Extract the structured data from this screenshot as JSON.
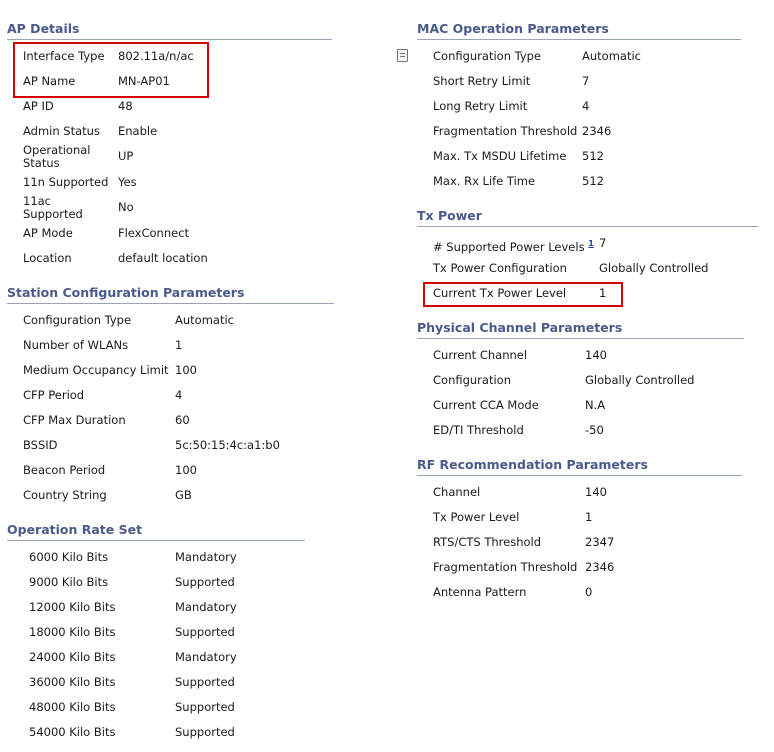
{
  "ap_details": {
    "title": "AP Details",
    "rows": [
      {
        "label": "Interface Type",
        "value": "802.11a/n/ac"
      },
      {
        "label": "AP Name",
        "value": "MN-AP01"
      },
      {
        "label": "AP ID",
        "value": "48"
      },
      {
        "label": "Admin Status",
        "value": "Enable"
      },
      {
        "label": "Operational Status",
        "value": "UP"
      },
      {
        "label": "11n Supported",
        "value": "Yes"
      },
      {
        "label": "11ac Supported",
        "value": "No"
      },
      {
        "label": "AP Mode",
        "value": "FlexConnect"
      },
      {
        "label": "Location",
        "value": "default location"
      }
    ]
  },
  "station_config": {
    "title": "Station Configuration Parameters",
    "rows": [
      {
        "label": "Configuration Type",
        "value": "Automatic"
      },
      {
        "label": "Number of WLANs",
        "value": "1"
      },
      {
        "label": "Medium Occupancy Limit",
        "value": "100"
      },
      {
        "label": "CFP Period",
        "value": "4"
      },
      {
        "label": "CFP Max Duration",
        "value": "60"
      },
      {
        "label": "BSSID",
        "value": "5c:50:15:4c:a1:b0"
      },
      {
        "label": "Beacon Period",
        "value": "100"
      },
      {
        "label": "Country String",
        "value": "GB"
      }
    ]
  },
  "operation_rate": {
    "title": "Operation Rate Set",
    "rows": [
      {
        "label": "6000 Kilo Bits",
        "value": "Mandatory"
      },
      {
        "label": "9000 Kilo Bits",
        "value": "Supported"
      },
      {
        "label": "12000 Kilo Bits",
        "value": "Mandatory"
      },
      {
        "label": "18000 Kilo Bits",
        "value": "Supported"
      },
      {
        "label": "24000 Kilo Bits",
        "value": "Mandatory"
      },
      {
        "label": "36000 Kilo Bits",
        "value": "Supported"
      },
      {
        "label": "48000 Kilo Bits",
        "value": "Supported"
      },
      {
        "label": "54000 Kilo Bits",
        "value": "Supported"
      }
    ]
  },
  "mac_operation": {
    "title": "MAC Operation Parameters",
    "rows": [
      {
        "label": "Configuration Type",
        "value": "Automatic"
      },
      {
        "label": "Short Retry Limit",
        "value": "7"
      },
      {
        "label": "Long Retry Limit",
        "value": "4"
      },
      {
        "label": "Fragmentation Threshold",
        "value": "2346"
      },
      {
        "label": "Max. Tx MSDU Lifetime",
        "value": "512"
      },
      {
        "label": "Max. Rx Life Time",
        "value": "512"
      }
    ]
  },
  "tx_power": {
    "title": "Tx Power",
    "footnote_mark": "1",
    "rows": [
      {
        "label": "# Supported Power Levels",
        "value": "7"
      },
      {
        "label": "Tx Power Configuration",
        "value": "Globally Controlled"
      },
      {
        "label": "Current Tx Power Level",
        "value": "1"
      }
    ]
  },
  "physical_channel": {
    "title": "Physical Channel Parameters",
    "rows": [
      {
        "label": "Current Channel",
        "value": "140"
      },
      {
        "label": "Configuration",
        "value": "Globally Controlled"
      },
      {
        "label": "Current CCA Mode",
        "value": "N.A"
      },
      {
        "label": "ED/TI Threshold",
        "value": "-50"
      }
    ]
  },
  "rf_recommendation": {
    "title": "RF Recommendation Parameters",
    "rows": [
      {
        "label": "Channel",
        "value": "140"
      },
      {
        "label": "Tx Power Level",
        "value": "1"
      },
      {
        "label": "RTS/CTS Threshold",
        "value": "2347"
      },
      {
        "label": "Fragmentation Threshold",
        "value": "2346"
      },
      {
        "label": "Antenna Pattern",
        "value": "0"
      }
    ]
  },
  "colors": {
    "section_title": "#4a5a8a",
    "highlight": "#d20000"
  }
}
